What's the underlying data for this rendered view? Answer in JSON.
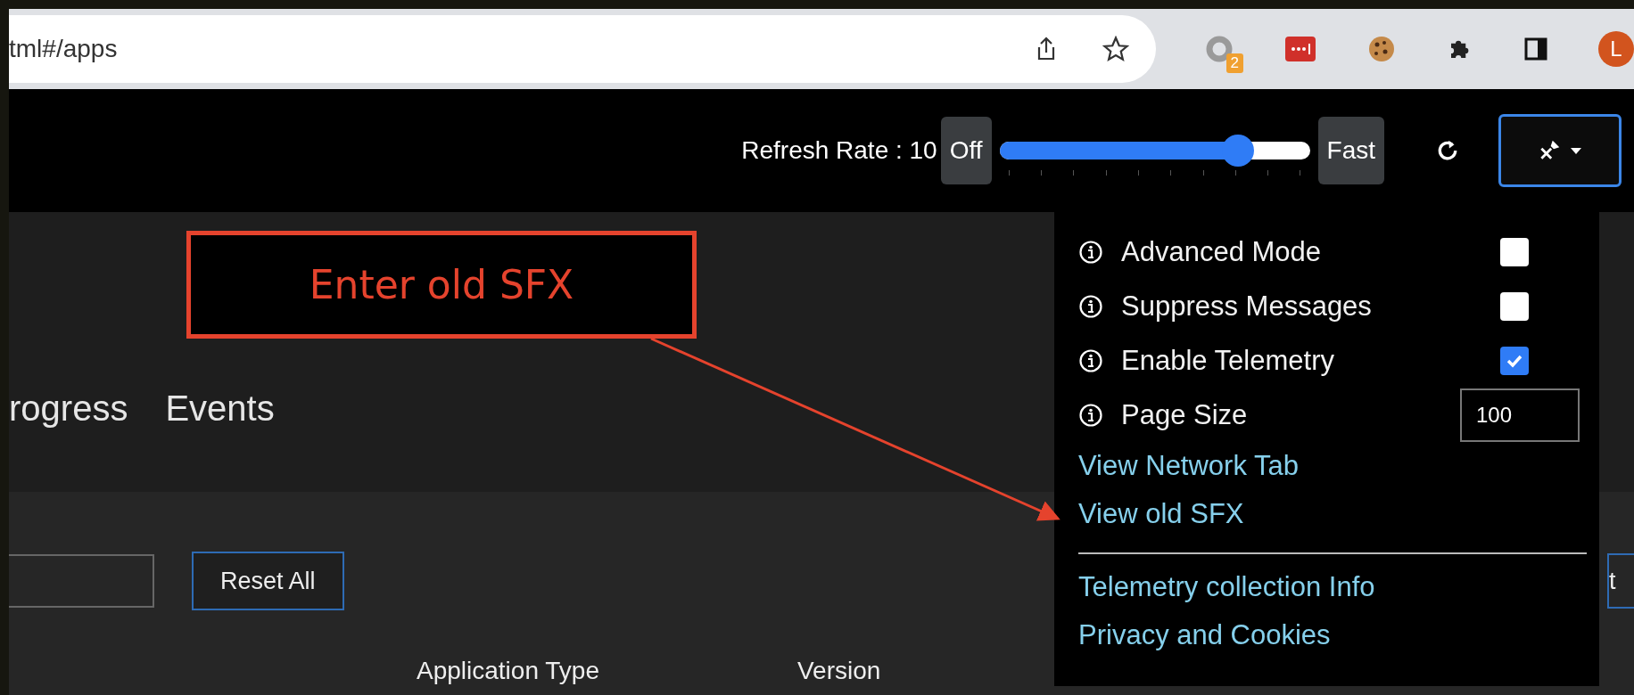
{
  "browser": {
    "url": "tml#/apps",
    "extension_badge": "2",
    "avatar": "L"
  },
  "header": {
    "refresh_label": "Refresh Rate : 10",
    "off_button": "Off",
    "slider": {
      "level": 0.77
    },
    "fast_button": "Fast"
  },
  "nav_tabs": [
    {
      "label": "rogress"
    },
    {
      "label": "Events"
    }
  ],
  "toolbar": {
    "reset_button": "Reset All",
    "partial_button": "t"
  },
  "table": {
    "columns": [
      "Application Type",
      "Version"
    ]
  },
  "settings_menu": {
    "options": [
      {
        "kind": "checkbox",
        "label": "Advanced Mode",
        "checked": false
      },
      {
        "kind": "checkbox",
        "label": "Suppress Messages",
        "checked": false
      },
      {
        "kind": "checkbox",
        "label": "Enable Telemetry",
        "checked": true
      },
      {
        "kind": "number",
        "label": "Page Size",
        "value": "100"
      }
    ],
    "links": [
      "View Network Tab",
      "View old SFX"
    ],
    "footer_links": [
      "Telemetry collection Info",
      "Privacy and Cookies"
    ]
  },
  "annotation": {
    "text": "Enter old SFX"
  }
}
